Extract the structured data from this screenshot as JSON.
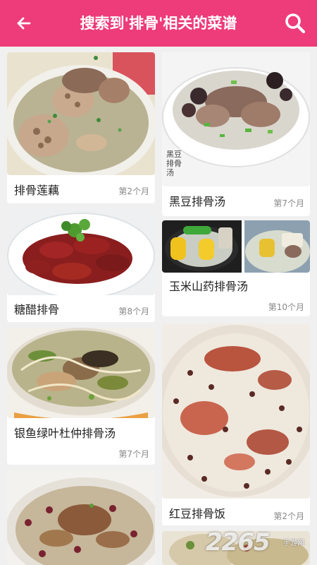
{
  "header": {
    "title": "搜索到'排骨'相关的菜谱",
    "back_icon": "back-arrow-icon",
    "search_icon": "search-icon",
    "bg_color": "#ee3b79"
  },
  "recipes": [
    {
      "name": "排骨莲藕",
      "time": "第2个月"
    },
    {
      "name": "黑豆排骨汤",
      "time": "第7个月"
    },
    {
      "name": "糖醋排骨",
      "time": "第8个月"
    },
    {
      "name": "玉米山药排骨汤",
      "time": "第10个月"
    },
    {
      "name": "银鱼绿叶杜仲排骨汤",
      "time": "第7个月"
    },
    {
      "name": "红豆排骨饭",
      "time": "第2个月"
    }
  ],
  "photo_labels": {
    "black_bean_soup": "黑豆排骨汤"
  },
  "watermark": {
    "text": "2265",
    "sub": "手游网"
  }
}
